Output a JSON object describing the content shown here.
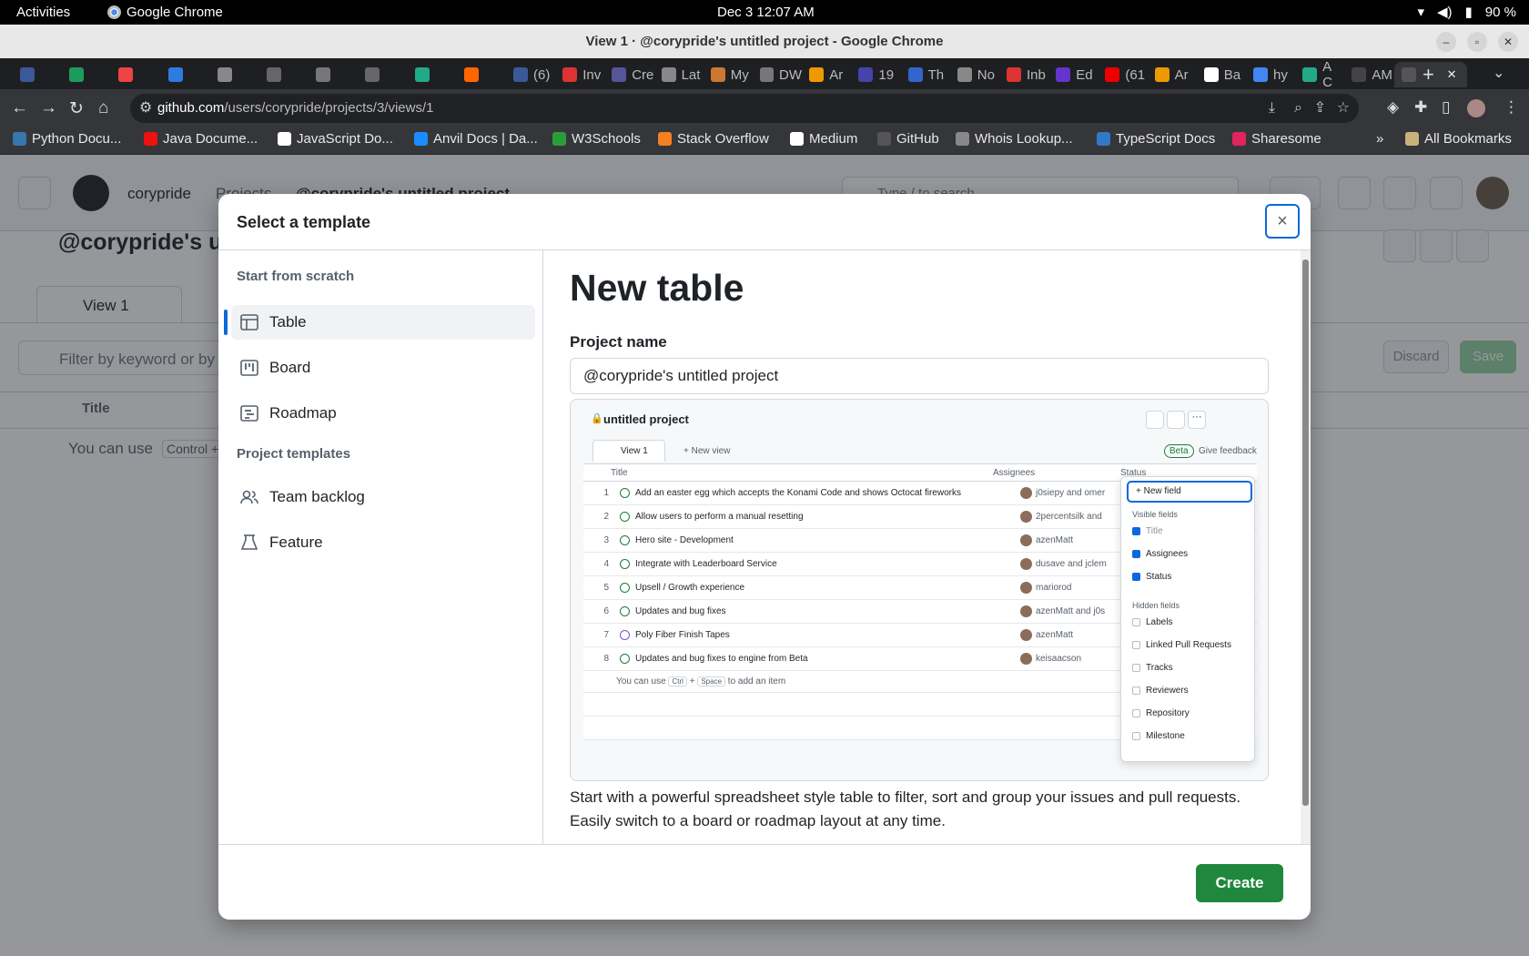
{
  "os": {
    "activities": "Activities",
    "app": "Google Chrome",
    "clock": "Dec 3  12:07 AM",
    "battery": "90 %"
  },
  "window": {
    "title": "View 1 · @corypride's untitled project - Google Chrome"
  },
  "tabs": [
    {
      "label": ""
    },
    {
      "label": ""
    },
    {
      "label": ""
    },
    {
      "label": ""
    },
    {
      "label": ""
    },
    {
      "label": ""
    },
    {
      "label": ""
    },
    {
      "label": ""
    },
    {
      "label": ""
    },
    {
      "label": ""
    },
    {
      "label": "(6)"
    },
    {
      "label": "Inv"
    },
    {
      "label": "Cre"
    },
    {
      "label": "Lat"
    },
    {
      "label": "My"
    },
    {
      "label": "DW"
    },
    {
      "label": "Ar"
    },
    {
      "label": "19"
    },
    {
      "label": "Th"
    },
    {
      "label": "No"
    },
    {
      "label": "Inb"
    },
    {
      "label": "Ed"
    },
    {
      "label": "(61"
    },
    {
      "label": "Ar"
    },
    {
      "label": "Ba"
    },
    {
      "label": "hy"
    },
    {
      "label": "A C"
    },
    {
      "label": "AM"
    },
    {
      "label": ""
    }
  ],
  "address": {
    "host": "github.com",
    "path": "/users/corypride/projects/3/views/1"
  },
  "bookmarks": [
    "Python Docu...",
    "Java Docume...",
    "JavaScript Do...",
    "Anvil Docs | Da...",
    "W3Schools",
    "Stack Overflow",
    "Medium",
    "GitHub",
    "Whois Lookup...",
    "TypeScript Docs",
    "Sharesome"
  ],
  "bookmarks_all": "All Bookmarks",
  "page": {
    "user": "corypride",
    "crumb": "Projects",
    "project_crumb": "@corypride's untitled project",
    "search_placeholder": "Type / to search",
    "project_title": "@corypride's u",
    "view_tab": "View 1",
    "filter_placeholder": "Filter by keyword or by",
    "discard": "Discard",
    "save": "Save",
    "col_title": "Title",
    "add_hint": "You can use",
    "add_key": "Control +"
  },
  "modal": {
    "title": "Select a template",
    "close": "×",
    "group_scratch": "Start from scratch",
    "scratch_items": [
      "Table",
      "Board",
      "Roadmap"
    ],
    "group_templates": "Project templates",
    "template_items": [
      "Team backlog",
      "Feature"
    ],
    "heading": "New table",
    "name_label": "Project name",
    "name_value": "@corypride's untitled project",
    "description": "Start with a powerful spreadsheet style table to filter, sort and group your issues and pull requests. Easily switch to a board or roadmap layout at any time.",
    "create": "Create"
  },
  "preview": {
    "title": "untitled project",
    "view": "View 1",
    "new_view": "+ New view",
    "beta": "Beta",
    "feedback": "Give feedback",
    "col_title": "Title",
    "col_assignees": "Assignees",
    "col_status": "Status",
    "rows": [
      {
        "n": "1",
        "title": "Add an easter egg which accepts the Konami Code and shows Octocat fireworks",
        "who": "j0siepy and omer",
        "done": false
      },
      {
        "n": "2",
        "title": "Allow users to perform a manual resetting",
        "who": "2percentsilk and",
        "done": false
      },
      {
        "n": "3",
        "title": "Hero site - Development",
        "who": "azenMatt",
        "done": false
      },
      {
        "n": "4",
        "title": "Integrate with Leaderboard Service",
        "who": "dusave and jclem",
        "done": false
      },
      {
        "n": "5",
        "title": "Upsell / Growth experience",
        "who": "mariorod",
        "done": false
      },
      {
        "n": "6",
        "title": "Updates and bug fixes",
        "who": "azenMatt and j0s",
        "done": false
      },
      {
        "n": "7",
        "title": "Poly Fiber Finish Tapes",
        "who": "azenMatt",
        "done": true
      },
      {
        "n": "8",
        "title": "Updates and bug fixes to engine from Beta",
        "who": "keisaacson",
        "done": false
      }
    ],
    "add_hint": "You can use",
    "key1": "Ctrl",
    "key2": "Space",
    "add_tail": "to add an item",
    "menu": {
      "new_field": "+ New field",
      "visible": "Visible fields",
      "visible_items": [
        "Title",
        "Assignees",
        "Status"
      ],
      "hidden": "Hidden fields",
      "hidden_items": [
        "Labels",
        "Linked Pull Requests",
        "Tracks",
        "Reviewers",
        "Repository",
        "Milestone"
      ]
    }
  },
  "colors": {
    "primary_green": "#1f883d",
    "focus_blue": "#0969da"
  }
}
